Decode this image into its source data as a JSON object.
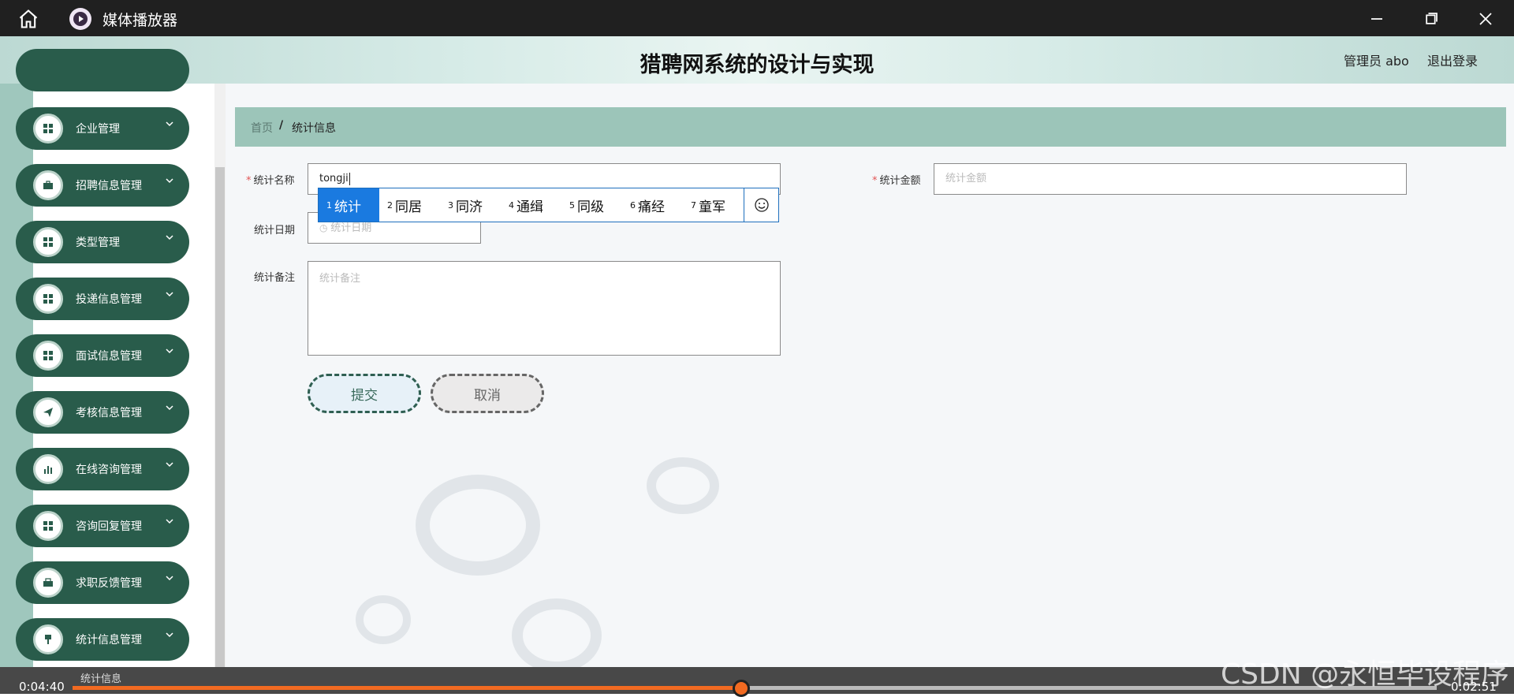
{
  "window": {
    "title": "媒体播放器"
  },
  "header": {
    "title": "猎聘网系统的设计与实现",
    "user": "管理员 abo",
    "logout": "退出登录"
  },
  "sidebar": {
    "items": [
      {
        "label": "企业管理",
        "icon": "grid-icon"
      },
      {
        "label": "招聘信息管理",
        "icon": "briefcase-icon"
      },
      {
        "label": "类型管理",
        "icon": "grid-icon"
      },
      {
        "label": "投递信息管理",
        "icon": "grid-icon"
      },
      {
        "label": "面试信息管理",
        "icon": "grid-icon"
      },
      {
        "label": "考核信息管理",
        "icon": "send-icon"
      },
      {
        "label": "在线咨询管理",
        "icon": "bar-chart-icon"
      },
      {
        "label": "咨询回复管理",
        "icon": "grid-icon"
      },
      {
        "label": "求职反馈管理",
        "icon": "toolbox-icon"
      },
      {
        "label": "统计信息管理",
        "icon": "pin-icon"
      }
    ]
  },
  "breadcrumb": {
    "home": "首页",
    "separator": "/",
    "current": "统计信息"
  },
  "form": {
    "name_label": "统计名称",
    "name_value": "tongji",
    "amount_label": "统计金额",
    "amount_placeholder": "统计金额",
    "date_label": "统计日期",
    "date_placeholder": "统计日期",
    "note_label": "统计备注",
    "note_placeholder": "统计备注",
    "submit_label": "提交",
    "cancel_label": "取消"
  },
  "ime": {
    "candidates": [
      {
        "num": "1",
        "text": "统计"
      },
      {
        "num": "2",
        "text": "同居"
      },
      {
        "num": "3",
        "text": "同济"
      },
      {
        "num": "4",
        "text": "通缉"
      },
      {
        "num": "5",
        "text": "同级"
      },
      {
        "num": "6",
        "text": "痛经"
      },
      {
        "num": "7",
        "text": "童军"
      }
    ]
  },
  "player": {
    "elapsed": "0:04:40",
    "remaining": "0:02:51",
    "tooltip": "统计信息",
    "progress_fraction": 0.49,
    "accent": "#f26a21"
  },
  "watermark": "CSDN @永恒毕设程序"
}
